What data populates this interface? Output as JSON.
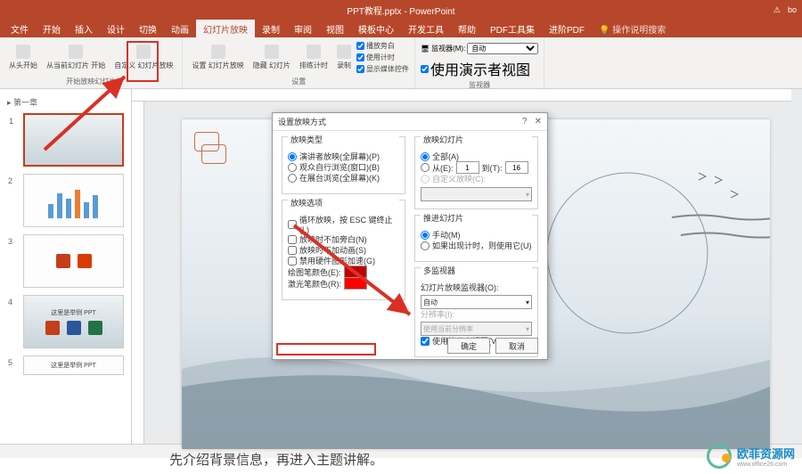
{
  "app": {
    "title": "PPT教程.pptx - PowerPoint",
    "user": "bo",
    "warn": "⚠"
  },
  "menu": {
    "tabs": [
      "文件",
      "开始",
      "插入",
      "设计",
      "切换",
      "动画",
      "幻灯片放映",
      "录制",
      "审阅",
      "视图",
      "模板中心",
      "开发工具",
      "帮助",
      "PDF工具集",
      "进阶PDF"
    ],
    "help": "操作说明搜索"
  },
  "ribbon": {
    "group1": {
      "btn1": "从头开始",
      "btn2": "从当前幻灯片\n开始",
      "btn3": "自定义\n幻灯片放映",
      "label": "开始放映幻灯片"
    },
    "group2": {
      "btn1": "设置\n幻灯片放映",
      "btn2": "隐藏\n幻灯片",
      "btn3": "排练计时",
      "btn4": "录制",
      "chk1": "播放旁白",
      "chk2": "使用计时",
      "chk3": "显示媒体控件",
      "label": "设置"
    },
    "group3": {
      "sel_label": "监视器(M):",
      "sel_val": "自动",
      "chk": "使用演示者视图",
      "label": "监视器"
    }
  },
  "slidepane": {
    "section": "第一章",
    "slides": [
      {
        "num": "1",
        "content": ""
      },
      {
        "num": "2",
        "content": ""
      },
      {
        "num": "3",
        "content": ""
      },
      {
        "num": "4",
        "content": "这里是举例 PPT"
      },
      {
        "num": "5",
        "content": "这里是举例 PPT"
      }
    ]
  },
  "dialog": {
    "title": "设置放映方式",
    "fs_type": {
      "legend": "放映类型",
      "r1": "演讲者放映(全屏幕)(P)",
      "r2": "观众自行浏览(窗口)(B)",
      "r3": "在展台浏览(全屏幕)(K)"
    },
    "fs_opt": {
      "legend": "放映选项",
      "c1": "循环放映，按 ESC 键终止(L)",
      "c2": "放映时不加旁白(N)",
      "c3": "放映时不加动画(S)",
      "c4": "禁用硬件图形加速(G)",
      "pen_label": "绘图笔颜色(E):",
      "laser_label": "激光笔颜色(R):"
    },
    "fs_slides": {
      "legend": "放映幻灯片",
      "r1": "全部(A)",
      "r2_from": "从(E):",
      "r2_to": "到(T):",
      "from_val": "1",
      "to_val": "16",
      "r3": "自定义放映(C):"
    },
    "fs_advance": {
      "legend": "推进幻灯片",
      "r1": "手动(M)",
      "r2": "如果出现计时，则使用它(U)"
    },
    "fs_multi": {
      "legend": "多监视器",
      "l1": "幻灯片放映监视器(O):",
      "v1": "自动",
      "l2": "分辨率(I):",
      "v2": "使用当前分辨率",
      "chk": "使用演示者视图(V)"
    },
    "ok": "确定",
    "cancel": "取消"
  },
  "caption": "先介绍背景信息，再进入主题讲解。",
  "watermark": {
    "name": "欧菲资源网",
    "url": "www.office26.com"
  }
}
